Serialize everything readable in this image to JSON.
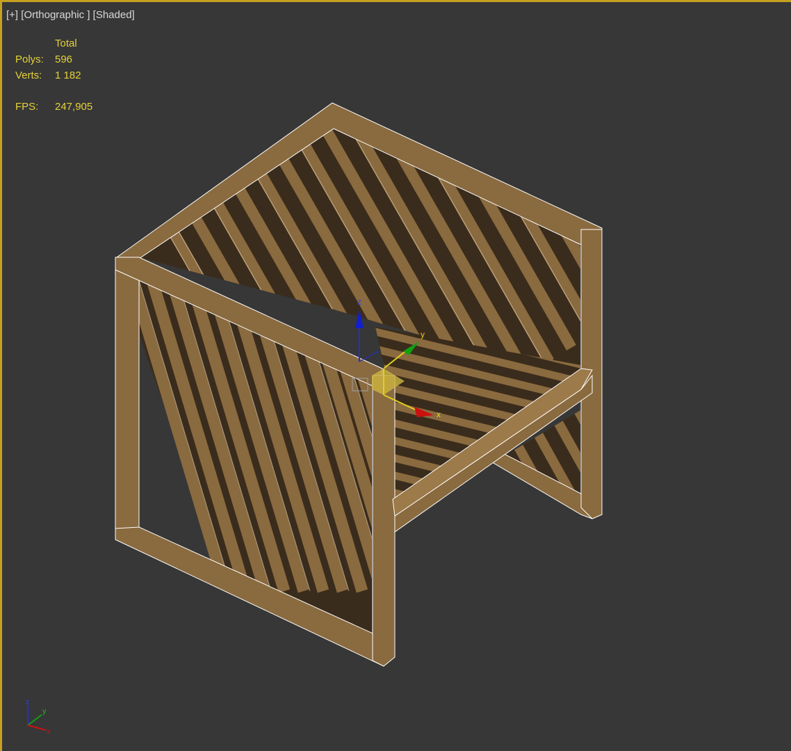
{
  "viewport": {
    "menu_label": "[+]",
    "view_label": "[Orthographic ]",
    "shading_label": "[Shaded]",
    "colors": {
      "background": "#373737",
      "active_border": "#c8a020",
      "stats_text": "#e4d23a",
      "wood": "#8a6a3f",
      "wireframe": "#ffffff"
    }
  },
  "stats": {
    "header": "Total",
    "polys_label": "Polys:",
    "polys_value": "596",
    "verts_label": "Verts:",
    "verts_value": "1 182",
    "fps_label": "FPS:",
    "fps_value": "247,905"
  },
  "gizmo": {
    "x_label": "x",
    "y_label": "y",
    "z_label": "z"
  },
  "view_axis": {
    "x_label": "x",
    "y_label": "y",
    "z_label": "z"
  },
  "scene_object": {
    "type": "wooden slatted armchair",
    "selected": true
  }
}
